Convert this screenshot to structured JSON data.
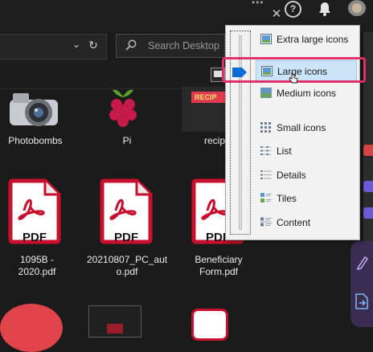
{
  "window": {
    "close_glyph": "✕",
    "help_glyph": "?",
    "overflow_glyph": "•••"
  },
  "address_bar": {
    "chevron": "⌄",
    "refresh": "↻"
  },
  "search": {
    "placeholder": "Search Desktop"
  },
  "files": [
    {
      "name": "Photobombs",
      "kind": "camera"
    },
    {
      "name": "Pi",
      "kind": "raspberry-pi"
    },
    {
      "name": "recip",
      "kind": "image",
      "banner": "RECIP"
    },
    {
      "name": "1095B - 2020.pdf",
      "kind": "pdf",
      "badge": "PDF"
    },
    {
      "name": "20210807_PC_auto.pdf",
      "kind": "pdf",
      "badge": "PDF"
    },
    {
      "name": "Beneficiary Form.pdf",
      "kind": "pdf",
      "badge": "PDF"
    }
  ],
  "file_labels": {
    "photobombs": "Photobombs",
    "pi": "Pi",
    "recipe": "recip",
    "pdf1": "1095B - 2020.pdf",
    "pdf2_line1": "20210807_PC_aut",
    "pdf2_line2": "o.pdf",
    "pdf3_line1": "Beneficiary",
    "pdf3_line2": "Form.pdf",
    "pdf_badge": "PDF",
    "recipe_banner": "RECIP"
  },
  "view_menu": {
    "selected": "Large icons",
    "items": [
      {
        "label": "Extra large icons",
        "icon": "extra-large-icons-icon"
      },
      {
        "label": "Large icons",
        "icon": "large-icons-icon"
      },
      {
        "label": "Medium icons",
        "icon": "medium-icons-icon"
      },
      {
        "label": "Small icons",
        "icon": "small-icons-icon"
      },
      {
        "label": "List",
        "icon": "list-icon"
      },
      {
        "label": "Details",
        "icon": "details-icon"
      },
      {
        "label": "Tiles",
        "icon": "tiles-icon"
      },
      {
        "label": "Content",
        "icon": "content-icon"
      }
    ]
  },
  "colors": {
    "accent": "#0a6cd6",
    "highlight": "#e0306a",
    "pdf_red": "#c8102e",
    "selected_bg": "#cce4f7"
  }
}
